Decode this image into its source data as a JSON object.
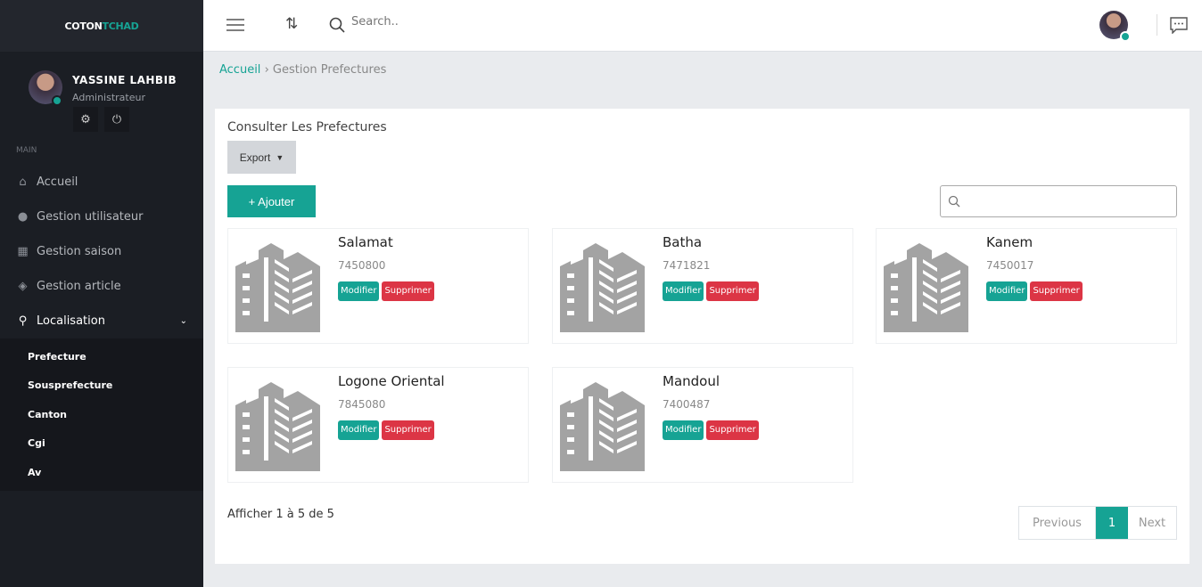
{
  "brand": {
    "part1": "COTON",
    "part2": "TCHAD"
  },
  "user": {
    "name": "YASSINE LAHBIB",
    "role": "Administrateur"
  },
  "sidebar": {
    "section": "MAIN",
    "items": [
      {
        "label": "Accueil",
        "icon": "home-icon"
      },
      {
        "label": "Gestion utilisateur",
        "icon": "user-icon"
      },
      {
        "label": "Gestion saison",
        "icon": "season-icon"
      },
      {
        "label": "Gestion article",
        "icon": "box-icon"
      },
      {
        "label": "Localisation",
        "icon": "map-pin-icon"
      }
    ],
    "subitems": [
      "Prefecture",
      "Sousprefecture",
      "Canton",
      "Cgi",
      "Av"
    ]
  },
  "topbar": {
    "search_placeholder": "Search.."
  },
  "breadcrumb": {
    "home": "Accueil",
    "sep": "›",
    "current": "Gestion Prefectures"
  },
  "panel": {
    "title": "Consulter Les Prefectures",
    "export": "Export",
    "add": "+ Ajouter",
    "cards": [
      {
        "name": "Salamat",
        "code": "7450800"
      },
      {
        "name": "Batha",
        "code": "7471821"
      },
      {
        "name": "Kanem",
        "code": "7450017"
      },
      {
        "name": "Logone Oriental",
        "code": "7845080"
      },
      {
        "name": "Mandoul",
        "code": "7400487"
      }
    ],
    "edit": "Modifier",
    "delete": "Supprimer",
    "info": "Afficher 1 à 5 de 5",
    "pager": {
      "prev": "Previous",
      "page": "1",
      "next": "Next"
    }
  },
  "colors": {
    "accent": "#16a394",
    "danger": "#dc3545",
    "sidebar": "#1b1e24"
  }
}
